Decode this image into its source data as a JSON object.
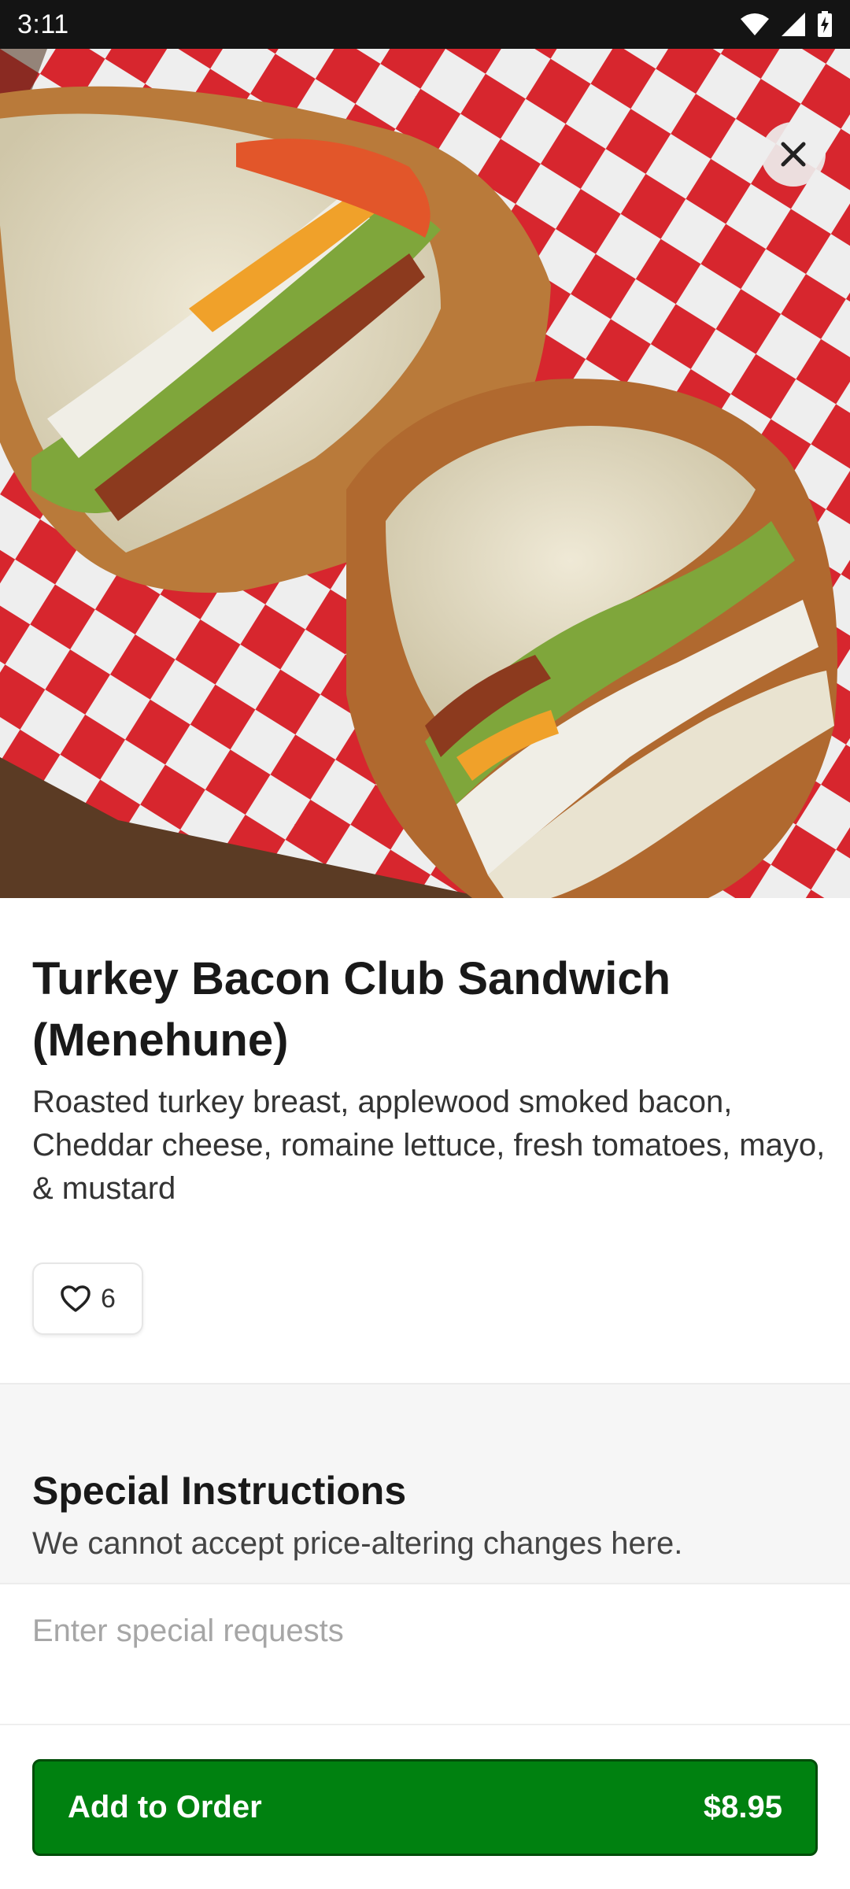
{
  "status_bar": {
    "time": "3:11",
    "icons": [
      "wifi-icon",
      "cellular-signal-icon",
      "battery-charging-icon"
    ]
  },
  "hero": {
    "image": "turkey-bacon-club-sandwich-photo",
    "close_icon": "close-icon"
  },
  "item": {
    "title": "Turkey Bacon Club Sandwich (Menehune)",
    "description": "Roasted turkey breast, applewood smoked bacon, Cheddar cheese, romaine lettuce, fresh tomatoes, mayo, & mustard",
    "likes": "6",
    "like_icon": "heart-outline-icon"
  },
  "special_instructions": {
    "title": "Special Instructions",
    "subtitle": "We cannot accept price-altering changes here.",
    "placeholder": "Enter special requests",
    "value": ""
  },
  "cta": {
    "label": "Add to Order",
    "price": "$8.95"
  },
  "colors": {
    "accent": "#008110",
    "accent_border": "#004d09",
    "status_bar": "#141414",
    "checker_red": "#d7262e",
    "text": "#191919",
    "section_bg": "#f6f6f6"
  }
}
